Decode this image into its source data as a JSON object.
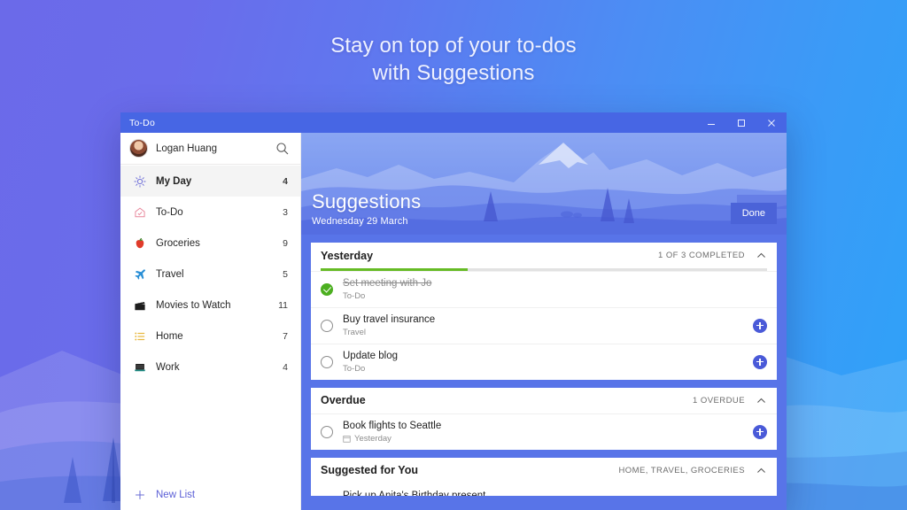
{
  "promo": {
    "line1": "Stay on top of your to-dos",
    "line2": "with Suggestions"
  },
  "window": {
    "title": "To-Do",
    "controls": {
      "minimize": "minimize-icon",
      "maximize": "maximize-icon",
      "close": "close-icon"
    }
  },
  "sidebar": {
    "account": {
      "name": "Logan Huang",
      "avatar": "user-avatar",
      "search_icon": "search-icon"
    },
    "items": [
      {
        "label": "My Day",
        "count": "4",
        "icon": "☀",
        "icon_name": "sun-icon",
        "selected": true
      },
      {
        "label": "To-Do",
        "count": "3",
        "icon": "⌂",
        "icon_name": "house-check-icon",
        "selected": false
      },
      {
        "label": "Groceries",
        "count": "9",
        "icon": "🍎",
        "icon_name": "apple-icon",
        "selected": false
      },
      {
        "label": "Travel",
        "count": "5",
        "icon": "✈",
        "icon_name": "airplane-icon",
        "selected": false
      },
      {
        "label": "Movies to Watch",
        "count": "11",
        "icon": "🎬",
        "icon_name": "clapperboard-icon",
        "selected": false
      },
      {
        "label": "Home",
        "count": "7",
        "icon": "☰",
        "icon_name": "list-icon",
        "selected": false
      },
      {
        "label": "Work",
        "count": "4",
        "icon": "💻",
        "icon_name": "laptop-icon",
        "selected": false
      }
    ],
    "new_list": {
      "label": "New List",
      "icon_name": "plus-icon"
    }
  },
  "main": {
    "hero": {
      "title": "Suggestions",
      "date": "Wednesday 29 March",
      "done_button": "Done"
    },
    "cards": [
      {
        "title": "Yesterday",
        "meta": "1 OF 3 COMPLETED",
        "collapse_icon": "chevron-up-icon",
        "progress_percent": 33,
        "tasks": [
          {
            "name": "Set meeting with Jo",
            "sub": "To-Do",
            "completed": true,
            "has_add": false,
            "sub_icon": null
          },
          {
            "name": "Buy travel insurance",
            "sub": "Travel",
            "completed": false,
            "has_add": true,
            "sub_icon": null
          },
          {
            "name": "Update blog",
            "sub": "To-Do",
            "completed": false,
            "has_add": true,
            "sub_icon": null
          }
        ]
      },
      {
        "title": "Overdue",
        "meta": "1 OVERDUE",
        "collapse_icon": "chevron-up-icon",
        "progress_percent": null,
        "tasks": [
          {
            "name": "Book flights to Seattle",
            "sub": "Yesterday",
            "completed": false,
            "has_add": true,
            "sub_icon": "calendar-icon"
          }
        ]
      },
      {
        "title": "Suggested for You",
        "meta": "HOME, TRAVEL, GROCERIES",
        "collapse_icon": "chevron-up-icon",
        "progress_percent": null,
        "clipped_task": "Pick up Anita's Birthday present",
        "tasks": []
      }
    ]
  },
  "colors": {
    "accent_blue": "#4a5ad8",
    "progress_green": "#66bb25",
    "done_green": "#4caf20",
    "titlebar": "#4766e4",
    "main_backdrop": "#5874e8"
  }
}
